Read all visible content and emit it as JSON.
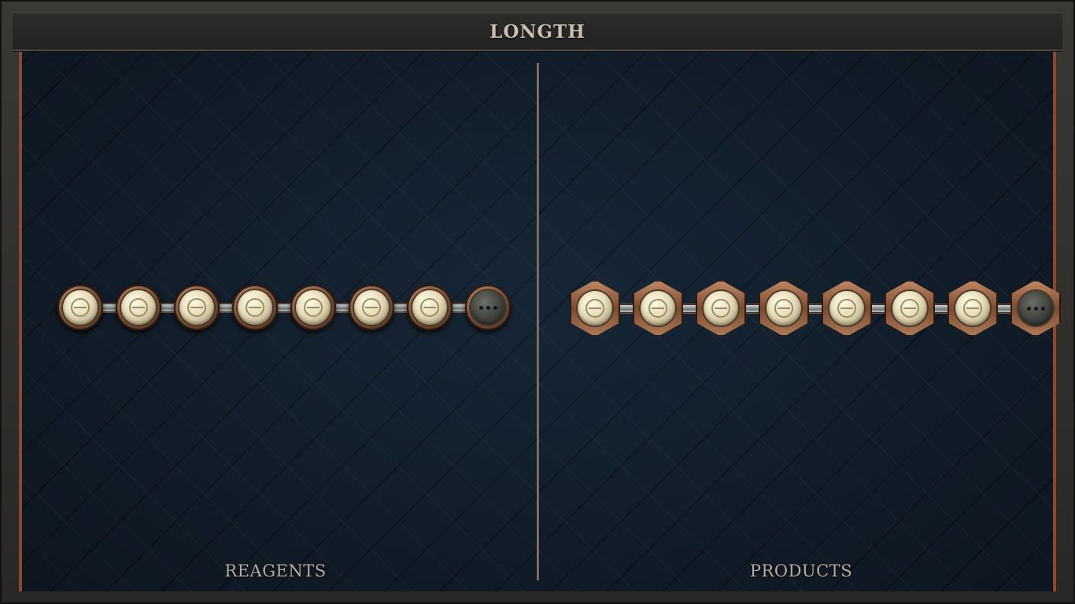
{
  "header": {
    "title": "LONGTH"
  },
  "reagents": {
    "label": "REAGENTS",
    "atoms": [
      "salt",
      "salt",
      "salt",
      "salt",
      "salt",
      "salt",
      "salt",
      "empty"
    ]
  },
  "products": {
    "label": "PRODUCTS",
    "atoms": [
      "salt",
      "salt",
      "salt",
      "salt",
      "salt",
      "salt",
      "salt",
      "empty"
    ]
  },
  "icons": {
    "atom": "salt-symbol-icon",
    "empty": "ellipsis-icon"
  },
  "colors": {
    "board": "#142130",
    "atom": "#e6dcb8",
    "bond": "#8a4a2a",
    "title": "#c9bfb0"
  }
}
